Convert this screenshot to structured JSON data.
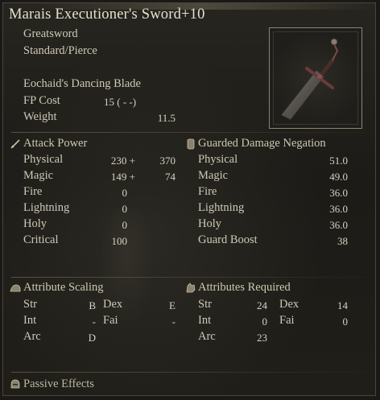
{
  "weapon": {
    "name": "Marais Executioner's Sword+10",
    "type": "Greatsword",
    "damage_type": "Standard/Pierce",
    "skill": "Eochaid's Dancing Blade",
    "fp_cost_label": "FP Cost",
    "fp_cost_value": "15 (      -      -)",
    "weight_label": "Weight",
    "weight_value": "11.5",
    "image_icon": "sword-icon"
  },
  "attack_power": {
    "header": "Attack Power",
    "icon": "sword-attack-icon",
    "rows": [
      {
        "label": "Physical",
        "base": "230 +",
        "bonus": "370"
      },
      {
        "label": "Magic",
        "base": "149 +",
        "bonus": "74"
      },
      {
        "label": "Fire",
        "base": "0",
        "bonus": ""
      },
      {
        "label": "Lightning",
        "base": "0",
        "bonus": ""
      },
      {
        "label": "Holy",
        "base": "0",
        "bonus": ""
      },
      {
        "label": "Critical",
        "base": "100",
        "bonus": ""
      }
    ]
  },
  "guarded_negation": {
    "header": "Guarded Damage Negation",
    "icon": "shield-icon",
    "rows": [
      {
        "label": "Physical",
        "value": "51.0"
      },
      {
        "label": "Magic",
        "value": "49.0"
      },
      {
        "label": "Fire",
        "value": "36.0"
      },
      {
        "label": "Lightning",
        "value": "36.0"
      },
      {
        "label": "Holy",
        "value": "36.0"
      },
      {
        "label": "Guard Boost",
        "value": "38"
      }
    ]
  },
  "attribute_scaling": {
    "header": "Attribute Scaling",
    "icon": "scaling-arm-icon",
    "rows": [
      {
        "l1": "Str",
        "v1": "B",
        "l2": "Dex",
        "v2": "E"
      },
      {
        "l1": "Int",
        "v1": "-",
        "l2": "Fai",
        "v2": "-"
      },
      {
        "l1": "Arc",
        "v1": "D",
        "l2": "",
        "v2": ""
      }
    ]
  },
  "attributes_required": {
    "header": "Attributes Required",
    "icon": "requirement-hand-icon",
    "rows": [
      {
        "l1": "Str",
        "v1": "24",
        "l2": "Dex",
        "v2": "14"
      },
      {
        "l1": "Int",
        "v1": "0",
        "l2": "Fai",
        "v2": "0"
      },
      {
        "l1": "Arc",
        "v1": "23",
        "l2": "",
        "v2": ""
      }
    ]
  },
  "passive_effects": {
    "header": "Passive Effects",
    "icon": "passive-helm-icon"
  }
}
